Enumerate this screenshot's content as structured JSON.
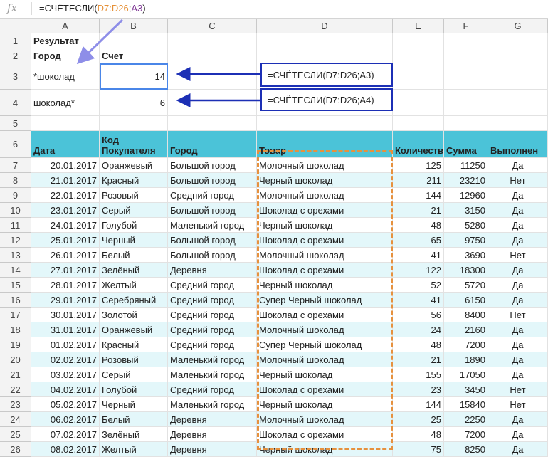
{
  "formula_bar": {
    "icon": "fx",
    "prefix": "=СЧЁТЕСЛИ(",
    "range_ref": "D7:D26",
    "separator": ";",
    "criteria_ref": "A3",
    "suffix": ")"
  },
  "column_headers": [
    "A",
    "B",
    "C",
    "D",
    "E",
    "F",
    "G"
  ],
  "row_headers": [
    "1",
    "2",
    "3",
    "4",
    "5",
    "6",
    "7",
    "8",
    "9",
    "10",
    "11",
    "12",
    "13",
    "14",
    "15",
    "16",
    "17",
    "18",
    "19",
    "20",
    "21",
    "22",
    "23",
    "24",
    "25",
    "26"
  ],
  "summary": {
    "title": "Результат",
    "city_label": "Город",
    "count_label": "Счет",
    "criteria_1": "*шоколад",
    "result_1": "14",
    "criteria_2": "шоколад*",
    "result_2": "6"
  },
  "annotations": {
    "formula_1": "=СЧЁТЕСЛИ(D7:D26;A3)",
    "formula_2": "=СЧЁТЕСЛИ(D7:D26;A4)"
  },
  "colors": {
    "header_fill": "#4bc3d8",
    "band_fill": "#e3f7fa",
    "arrow": "#1c2fb5",
    "dashed_outline": "#e6913e"
  },
  "table": {
    "columns": [
      "Дата",
      "Код Покупателя",
      "Город",
      "Товар",
      "Количество",
      "Сумма",
      "Выполнен"
    ],
    "rows": [
      [
        "20.01.2017",
        "Оранжевый",
        "Большой город",
        "Молочный шоколад",
        "125",
        "11250",
        "Да"
      ],
      [
        "21.01.2017",
        "Красный",
        "Большой город",
        "Черный шоколад",
        "211",
        "23210",
        "Нет"
      ],
      [
        "22.01.2017",
        "Розовый",
        "Средний город",
        "Молочный шоколад",
        "144",
        "12960",
        "Да"
      ],
      [
        "23.01.2017",
        "Серый",
        "Большой город",
        "Шоколад с орехами",
        "21",
        "3150",
        "Да"
      ],
      [
        "24.01.2017",
        "Голубой",
        "Маленький город",
        "Черный шоколад",
        "48",
        "5280",
        "Да"
      ],
      [
        "25.01.2017",
        "Черный",
        "Большой город",
        "Шоколад с орехами",
        "65",
        "9750",
        "Да"
      ],
      [
        "26.01.2017",
        "Белый",
        "Большой город",
        "Молочный шоколад",
        "41",
        "3690",
        "Нет"
      ],
      [
        "27.01.2017",
        "Зелёный",
        "Деревня",
        "Шоколад с орехами",
        "122",
        "18300",
        "Да"
      ],
      [
        "28.01.2017",
        "Желтый",
        "Средний город",
        "Черный шоколад",
        "52",
        "5720",
        "Да"
      ],
      [
        "29.01.2017",
        "Серебряный",
        "Средний город",
        "Супер Черный шоколад",
        "41",
        "6150",
        "Да"
      ],
      [
        "30.01.2017",
        "Золотой",
        "Средний город",
        "Шоколад с орехами",
        "56",
        "8400",
        "Нет"
      ],
      [
        "31.01.2017",
        "Оранжевый",
        "Средний город",
        "Молочный шоколад",
        "24",
        "2160",
        "Да"
      ],
      [
        "01.02.2017",
        "Красный",
        "Средний город",
        "Супер Черный шоколад",
        "48",
        "7200",
        "Да"
      ],
      [
        "02.02.2017",
        "Розовый",
        "Маленький город",
        "Молочный шоколад",
        "21",
        "1890",
        "Да"
      ],
      [
        "03.02.2017",
        "Серый",
        "Маленький город",
        "Черный шоколад",
        "155",
        "17050",
        "Да"
      ],
      [
        "04.02.2017",
        "Голубой",
        "Средний город",
        "Шоколад с орехами",
        "23",
        "3450",
        "Нет"
      ],
      [
        "05.02.2017",
        "Черный",
        "Маленький город",
        "Черный шоколад",
        "144",
        "15840",
        "Нет"
      ],
      [
        "06.02.2017",
        "Белый",
        "Деревня",
        "Молочный шоколад",
        "25",
        "2250",
        "Да"
      ],
      [
        "07.02.2017",
        "Зелёный",
        "Деревня",
        "Шоколад с орехами",
        "48",
        "7200",
        "Да"
      ],
      [
        "08.02.2017",
        "Желтый",
        "Деревня",
        "Черный шоколад",
        "75",
        "8250",
        "Да"
      ]
    ]
  }
}
